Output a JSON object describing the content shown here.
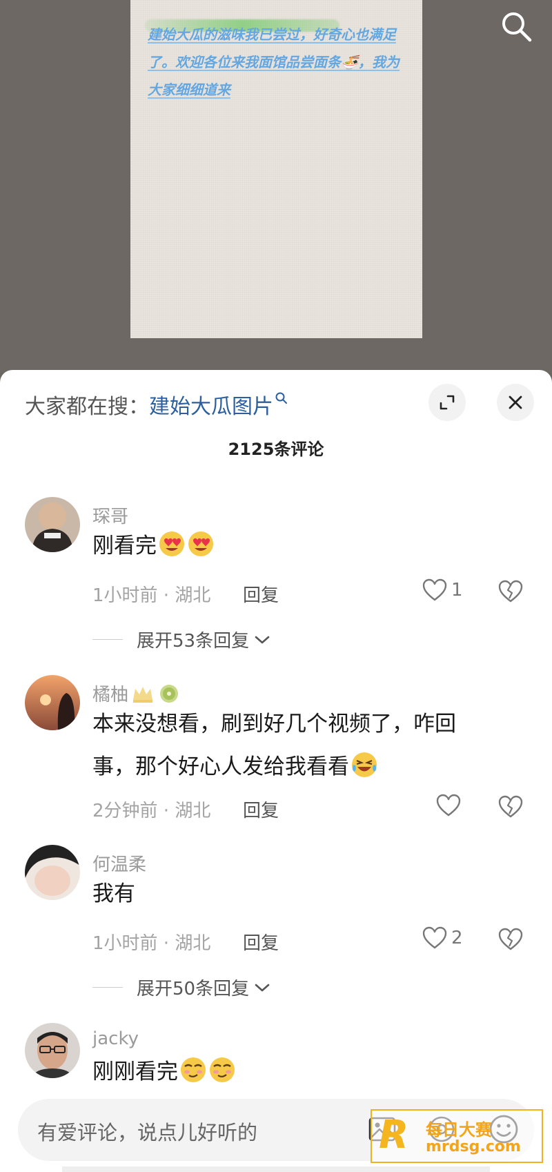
{
  "video": {
    "caption": "建始大瓜的滋味我已尝过，好奇心也满足了。欢迎各位来我面馆品尝面条🍜，我为大家细细道来",
    "search_icon": "search-icon"
  },
  "header": {
    "search_prefix": "大家都在搜：",
    "search_keyword": "建始大瓜图片",
    "expand_icon": "expand-icon",
    "close_icon": "close-icon",
    "comment_count": "2125条评论"
  },
  "comments": [
    {
      "user": "琛哥",
      "text": "刚看完",
      "emoji": "heart-eyes-emoji",
      "time_location": "1小时前 · 湖北",
      "reply_label": "回复",
      "likes": "1",
      "expand_label": "展开53条回复"
    },
    {
      "user": "橘柚",
      "badges": [
        "crown-icon",
        "kiwi-icon"
      ],
      "text_line1": "本来没想看，刷到好几个视频了，咋回",
      "text_line2": "事，那个好心人发给我看看",
      "emoji": "laughing-emoji",
      "time_location": "2分钟前 · 湖北",
      "reply_label": "回复",
      "likes": ""
    },
    {
      "user": "何温柔",
      "text": "我有",
      "time_location": "1小时前 · 湖北",
      "reply_label": "回复",
      "likes": "2",
      "expand_label": "展开50条回复"
    },
    {
      "user": "jacky",
      "text": "刚刚看完",
      "emoji": "smirk-emoji"
    }
  ],
  "input": {
    "placeholder": "有爱评论，说点儿好听的",
    "image_icon": "image-icon",
    "at_icon": "at-icon",
    "emoji_icon": "smile-icon"
  },
  "watermark": {
    "title": "每日大赛",
    "url": "mrdsg.com"
  },
  "colors": {
    "keyword": "#2c5f9e",
    "caption": "#63a7e2",
    "like_heart": "#777777",
    "watermark": "#f3b11c"
  }
}
